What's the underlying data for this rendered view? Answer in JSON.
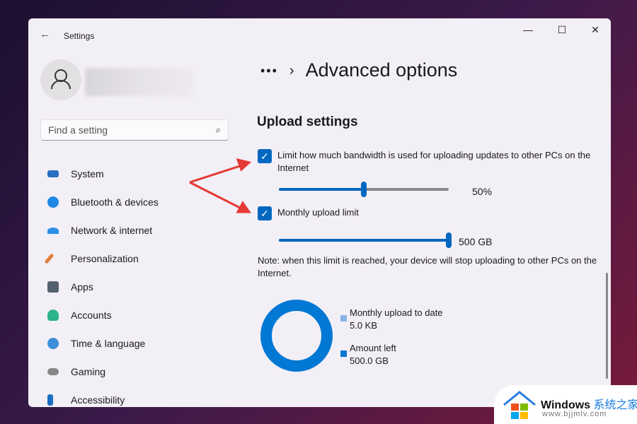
{
  "window": {
    "title": "Settings",
    "minimize": "—",
    "maximize": "☐",
    "close": "✕",
    "back": "←"
  },
  "search": {
    "placeholder": "Find a setting",
    "icon": "search-icon"
  },
  "sidebar": {
    "items": [
      {
        "label": "System",
        "color": "#2a6fc0"
      },
      {
        "label": "Bluetooth & devices",
        "color": "#1e88e5"
      },
      {
        "label": "Network & internet",
        "color": "#2b8fe6"
      },
      {
        "label": "Personalization",
        "color": "#e0803a"
      },
      {
        "label": "Apps",
        "color": "#556070"
      },
      {
        "label": "Accounts",
        "color": "#2eb38a"
      },
      {
        "label": "Time & language",
        "color": "#3a8fd8"
      },
      {
        "label": "Gaming",
        "color": "#888"
      },
      {
        "label": "Accessibility",
        "color": "#1a6fc0"
      }
    ]
  },
  "header": {
    "dots": "•••",
    "chevron": "›",
    "title": "Advanced options"
  },
  "upload": {
    "heading": "Upload settings",
    "bandwidth_label": "Limit how much bandwidth is used for uploading updates to other PCs on the Internet",
    "bandwidth_checked": true,
    "bandwidth_value": "50%",
    "bandwidth_fraction": 0.5,
    "monthly_label": "Monthly upload limit",
    "monthly_checked": true,
    "monthly_value": "500 GB",
    "monthly_fraction": 1.0,
    "note": "Note: when this limit is reached, your device will stop uploading to other PCs on the Internet.",
    "legend": [
      {
        "label": "Monthly upload to date",
        "value": "5.0 KB",
        "color": "#8ab4e8"
      },
      {
        "label": "Amount left",
        "value": "500.0 GB",
        "color": "#0078d4"
      }
    ]
  },
  "watermark": {
    "brand": "Windows",
    "cn": "系统之家",
    "url": "www.bjjmlv.com"
  },
  "accent": "#0067c0",
  "annotation_color": "#e53935"
}
